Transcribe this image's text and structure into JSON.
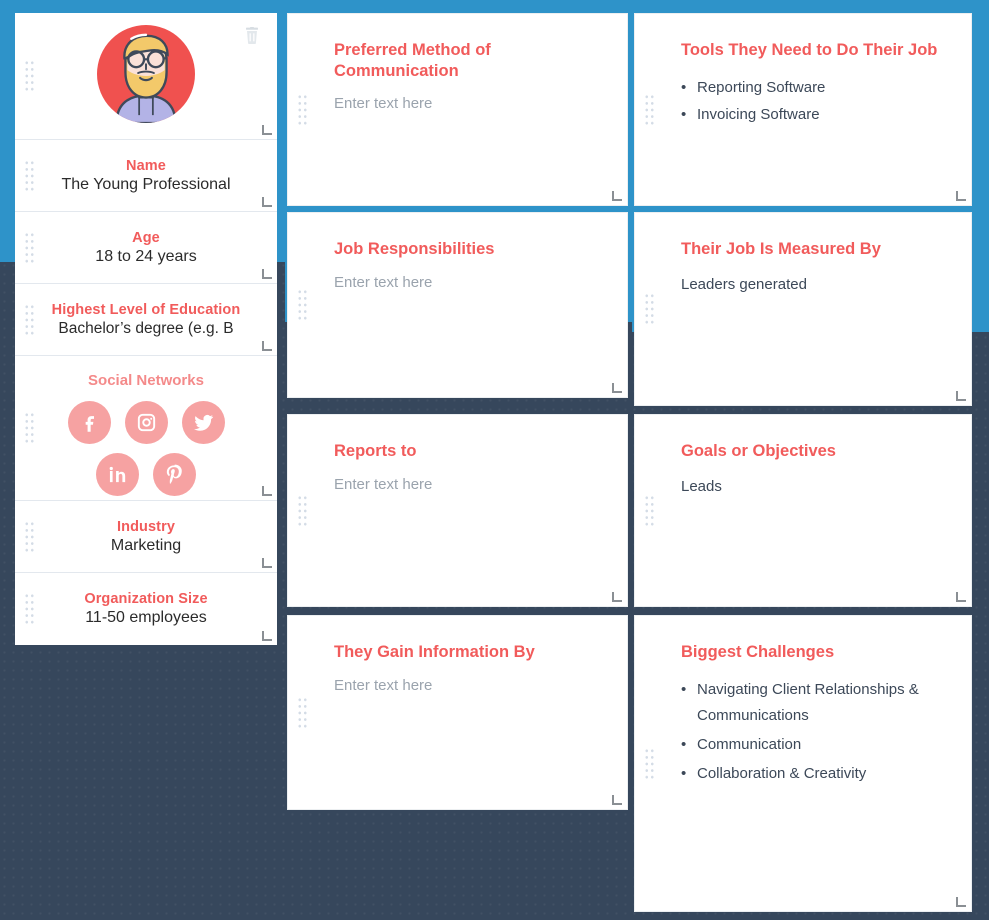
{
  "theme": {
    "accent_red": "#f15b5b",
    "accent_blue": "#2e93c9",
    "background_navy": "#36475c",
    "social_pink": "#f6a2a2",
    "avatar_circle": "#f0514f"
  },
  "sidebar": {
    "avatar": {
      "icon": "bearded-man-with-glasses-avatar",
      "delete_icon": "trash-icon"
    },
    "fields": [
      {
        "title": "Name",
        "value": "The Young Professional"
      },
      {
        "title": "Age",
        "value": "18 to 24 years"
      },
      {
        "title": "Highest Level of Education",
        "value": "Bachelor’s degree (e.g. B"
      },
      {
        "title": "Industry",
        "value": "Marketing"
      },
      {
        "title": "Organization Size",
        "value": "11-50 employees"
      }
    ],
    "social": {
      "title": "Social Networks",
      "networks": [
        {
          "name": "facebook-icon",
          "label": "Facebook"
        },
        {
          "name": "instagram-icon",
          "label": "Instagram"
        },
        {
          "name": "twitter-icon",
          "label": "Twitter"
        },
        {
          "name": "linkedin-icon",
          "label": "LinkedIn"
        },
        {
          "name": "pinterest-icon",
          "label": "Pinterest"
        }
      ]
    }
  },
  "cards": {
    "communication": {
      "title": "Preferred Method of Communication",
      "placeholder": "Enter text here"
    },
    "tools": {
      "title": "Tools They Need to Do Their Job",
      "items": [
        "Reporting Software",
        "Invoicing Software"
      ]
    },
    "job_responsibilities": {
      "title": "Job Responsibilities",
      "placeholder": "Enter text here"
    },
    "measured_by": {
      "title": "Their Job Is Measured By",
      "text": "Leaders generated"
    },
    "reports_to": {
      "title": "Reports to",
      "placeholder": "Enter text here"
    },
    "goals": {
      "title": "Goals or Objectives",
      "text": "Leads"
    },
    "gain_information": {
      "title": "They Gain Information By",
      "placeholder": "Enter text here"
    },
    "challenges": {
      "title": "Biggest Challenges",
      "items": [
        "Navigating Client Relationships & Communications",
        "Communication",
        "Collaboration & Creativity"
      ]
    }
  }
}
